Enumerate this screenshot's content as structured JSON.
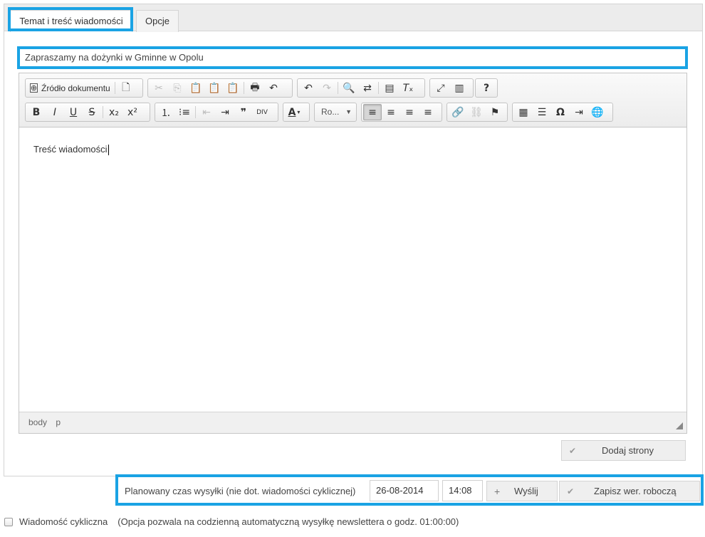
{
  "tabs": [
    {
      "label": "Temat i treść wiadomości",
      "active": true
    },
    {
      "label": "Opcje",
      "active": false
    }
  ],
  "subject": {
    "value": "Zapraszamy na dożynki w Gminne w Opolu"
  },
  "toolbar": {
    "source_label": "Źródło dokumentu",
    "font_combo": "Ro...",
    "color_label": "A"
  },
  "editor": {
    "content": "Treść wiadomości",
    "path": [
      "body",
      "p"
    ]
  },
  "buttons": {
    "add_pages": "Dodaj strony",
    "send": "Wyślij",
    "save_draft": "Zapisz wer. roboczą"
  },
  "schedule": {
    "label": "Planowany czas wysyłki (nie dot. wiadomości cyklicznej)",
    "date": "26-08-2014",
    "time": "14:08"
  },
  "cyclic": {
    "label": "Wiadomość cykliczna",
    "note": "(Opcja pozwala na codzienną automatyczną wysyłkę newslettera o godz. 01:00:00)",
    "checked": false
  },
  "colors": {
    "highlight": "#1aa3e4",
    "panel_border": "#d4d4d4"
  }
}
